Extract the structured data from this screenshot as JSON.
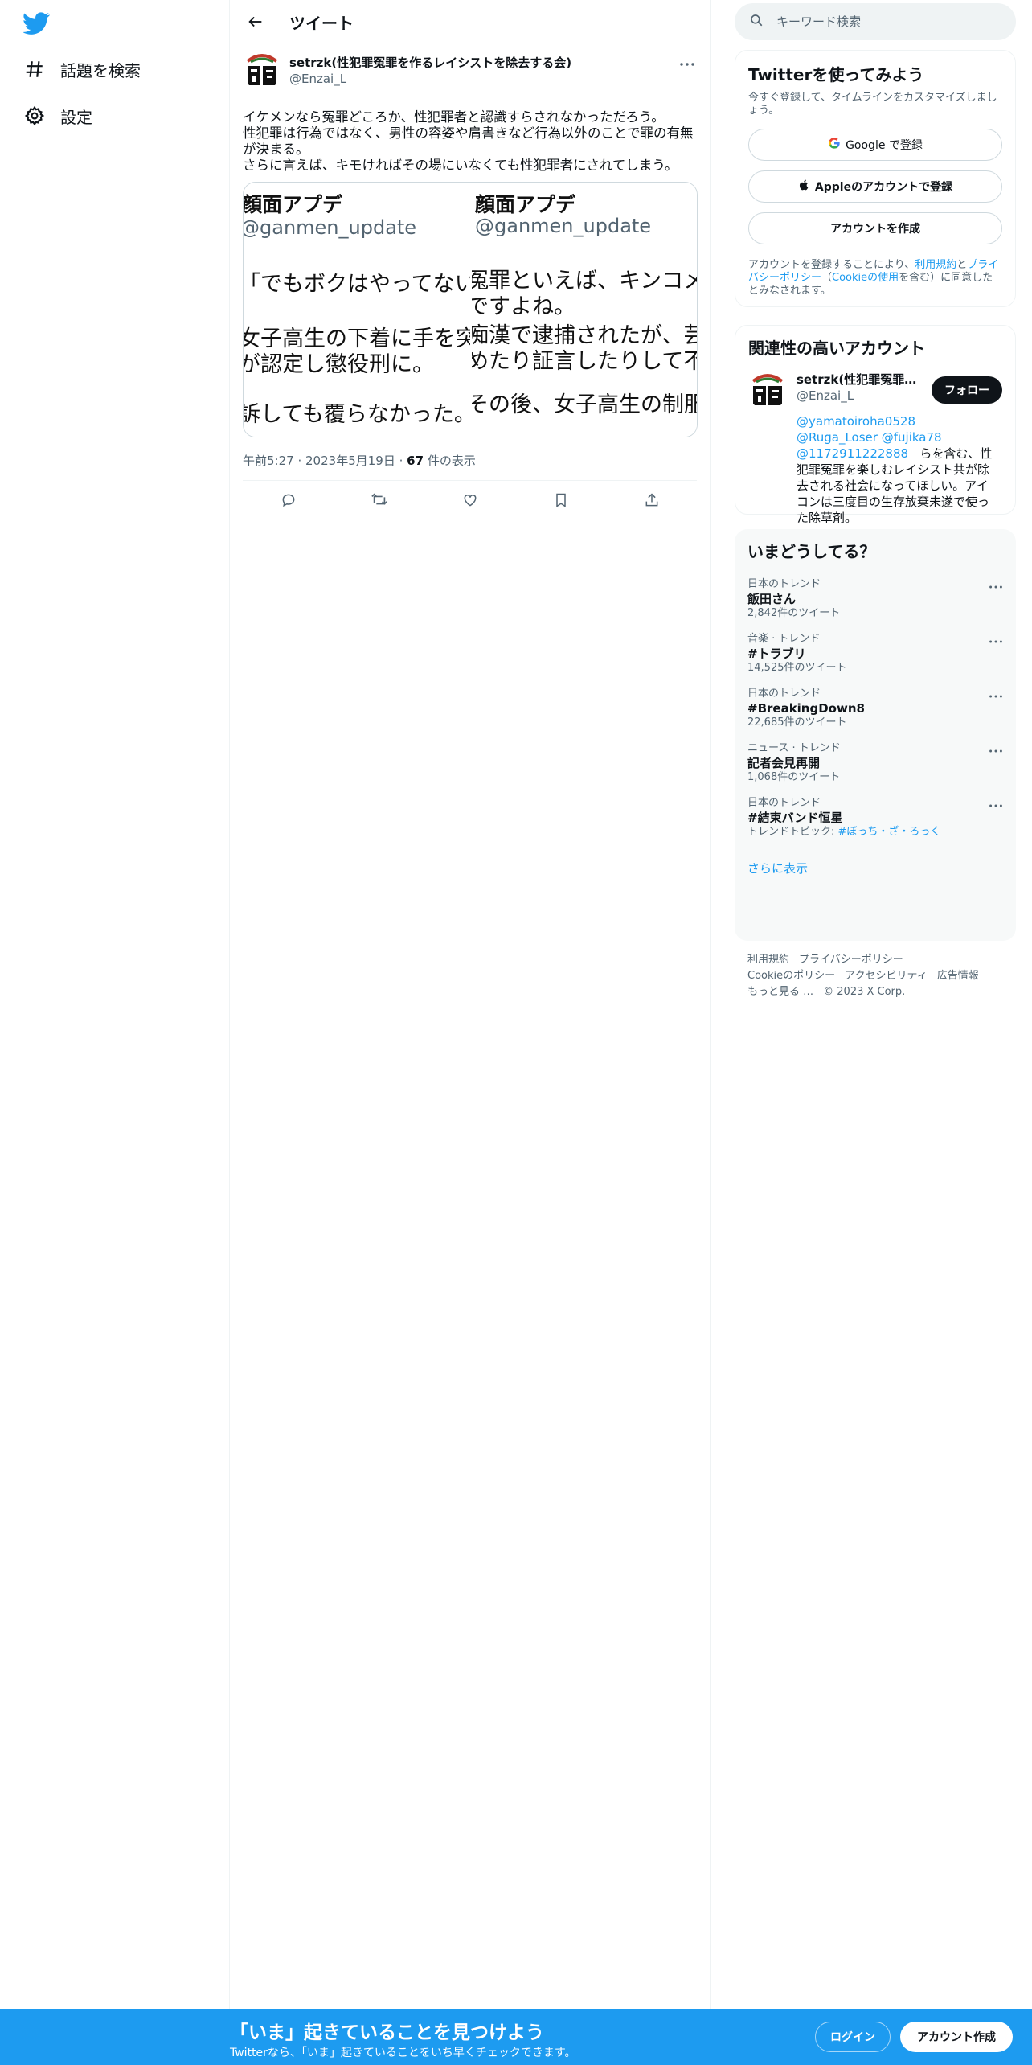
{
  "nav": {
    "items": [
      {
        "label": "話題を検索",
        "icon": "hashtag-icon"
      },
      {
        "label": "設定",
        "icon": "gear-icon"
      }
    ]
  },
  "header": {
    "title": "ツイート"
  },
  "tweet": {
    "author_name": "setrzk(性犯罪冤罪を作るレイシストを除去する会)",
    "author_handle": "@Enzai_L",
    "text": "イケメンなら冤罪どころか、性犯罪者と認識すらされなかっただろう。\n性犯罪は行為ではなく、男性の容姿や肩書きなど行為以外のことで罪の有無が決まる。\nさらに言えば、キモければその場にいなくても性犯罪者にされてしまう。",
    "media": {
      "left": {
        "title": "顔面アプデ",
        "handle": "@ganmen_update",
        "lines": [
          "「でもボクはやってない」(",
          "女子高生の下着に手を突っ",
          "が認定し懲役刑に。",
          "訴しても覆らなかった。"
        ]
      },
      "right": {
        "title": "顔面アプデ",
        "handle": "@ganmen_update",
        "lines": [
          "冤罪といえば、キンコメの",
          "ですよね。",
          "痴漢で逮捕されたが、芸人仲",
          "めたり証言したりして不起",
          "その後、女子高生の制服を"
        ]
      }
    },
    "time": "午前5:27",
    "date": "2023年5月19日",
    "views_count": "67",
    "views_label": "件の表示"
  },
  "search": {
    "placeholder": "キーワード検索"
  },
  "signup": {
    "title": "Twitterを使ってみよう",
    "subtitle": "今すぐ登録して、タイムラインをカスタマイズしましょう。",
    "google_label": "Google で登録",
    "apple_label": "Appleのアカウントで登録",
    "create_label": "アカウントを作成",
    "legal_pre": "アカウントを登録することにより、",
    "legal_terms": "利用規約",
    "legal_and": "と",
    "legal_privacy": "プライバシーポリシー",
    "legal_paren_open": "（",
    "legal_cookie": "Cookieの使用",
    "legal_post": "を含む）に同意したとみなされます。"
  },
  "related": {
    "title": "関連性の高いアカウント",
    "name": "setrzk(性犯罪冤罪を作るレイシストを除去する会)",
    "handle": "@Enzai_L",
    "follow_label": "フォロー",
    "mentions": [
      "@yamatoiroha0528",
      "@Ruga_Loser",
      "@fujika78",
      "@1172911222888"
    ],
    "bio_rest": "らを含む、性犯罪冤罪を楽しむレイシスト共が除去される社会になってほしい。アイコンは三度目の生存放棄未遂で使った除草剤。"
  },
  "trends": {
    "title": "いまどうしてる？",
    "items": [
      {
        "category": "日本のトレンド",
        "name": "飯田さん",
        "count": "2,842件のツイート"
      },
      {
        "category": "音楽 · トレンド",
        "name": "#トラブリ",
        "count": "14,525件のツイート"
      },
      {
        "category": "日本のトレンド",
        "name": "#BreakingDown8",
        "count": "22,685件のツイート"
      },
      {
        "category": "ニュース · トレンド",
        "name": "記者会見再開",
        "count": "1,068件のツイート"
      },
      {
        "category": "日本のトレンド",
        "name": "#結束バンド恒星",
        "topic_prefix": "トレンドトピック: ",
        "topic": "#ぼっち・ざ・ろっく"
      }
    ],
    "show_more": "さらに表示"
  },
  "footer": {
    "links": [
      "利用規約",
      "プライバシーポリシー",
      "Cookieのポリシー",
      "アクセシビリティ",
      "広告情報",
      "もっと見る …"
    ],
    "copyright": "© 2023 X Corp."
  },
  "bottombar": {
    "title": "「いま」起きていることを見つけよう",
    "subtitle": "Twitterなら、「いま」起きていることをいち早くチェックできます。",
    "login_label": "ログイン",
    "create_label": "アカウント作成"
  },
  "colors": {
    "accent": "#1d9bf0",
    "text": "#0f1419",
    "secondary": "#536471"
  }
}
